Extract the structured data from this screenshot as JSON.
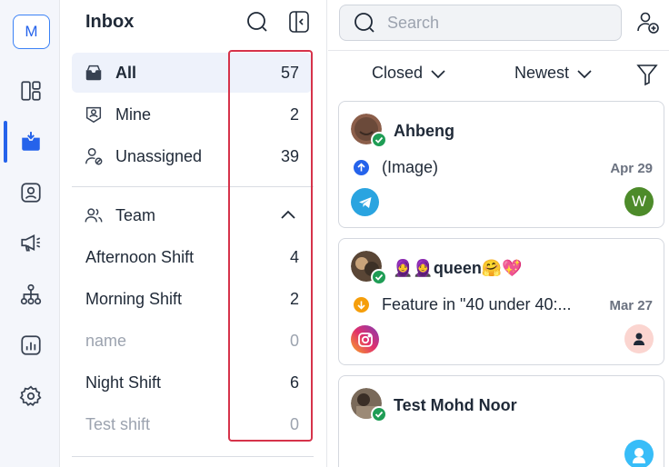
{
  "rail": {
    "workspace_initial": "M",
    "items": [
      {
        "icon": "dashboard-icon"
      },
      {
        "icon": "inbox-icon",
        "active": true
      },
      {
        "icon": "contacts-icon"
      },
      {
        "icon": "broadcast-icon"
      },
      {
        "icon": "workflow-icon"
      },
      {
        "icon": "reports-icon"
      },
      {
        "icon": "settings-icon"
      }
    ]
  },
  "inbox": {
    "title": "Inbox",
    "items": [
      {
        "label": "All",
        "count": "57",
        "icon": "inbox-icon"
      },
      {
        "label": "Mine",
        "count": "2",
        "icon": "user-badge-icon"
      },
      {
        "label": "Unassigned",
        "count": "39",
        "icon": "user-unassigned-icon"
      }
    ],
    "team": {
      "label": "Team",
      "icon": "team-icon"
    },
    "shifts": [
      {
        "label": "Afternoon Shift",
        "count": "4"
      },
      {
        "label": "Morning Shift",
        "count": "2"
      },
      {
        "label": "name",
        "count": "0"
      },
      {
        "label": "Night Shift",
        "count": "6"
      },
      {
        "label": "Test shift",
        "count": "0"
      }
    ]
  },
  "conversations": {
    "search_placeholder": "Search",
    "status_filter": "Closed",
    "sort_filter": "Newest",
    "cards": [
      {
        "name": "Ahbeng",
        "message": "(Image)",
        "date": "Apr 29",
        "direction": "outgoing",
        "channel": "telegram",
        "agent_initial": "W"
      },
      {
        "name": "🧕🧕queen🤗💖",
        "message": "Feature in \"40 under 40:...",
        "date": "Mar 27",
        "direction": "incoming",
        "channel": "instagram"
      },
      {
        "name": "Test Mohd Noor"
      }
    ]
  },
  "colors": {
    "accent": "#2563eb",
    "highlight": "#d6334a",
    "online": "#1f9d55",
    "telegram": "#2aa4e0",
    "incoming": "#f59e0b"
  }
}
